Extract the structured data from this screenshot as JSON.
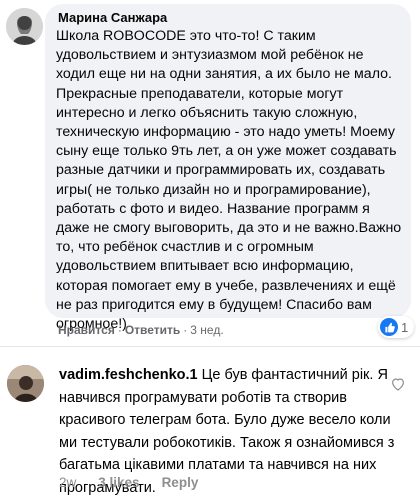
{
  "comment1": {
    "author": "Марина Санжара",
    "text": "Школа ROBOCODE это что-то! С таким удовольствием и энтузиазмом мой ребёнок не ходил еще ни на одни занятия, а их было не мало. Прекрасные преподаватели, которые могут интересно и легко объяснить такую сложную, техническую информацию - это надо уметь! Моему сыну еще только 9ть лет, а он уже может создавать разные датчики и программировать их, создавать игры( не только дизайн но и програмирование), работать с фото и видео. Название программ я даже не смогу выговорить, да это и не важно.Важно то, что ребёнок счастлив и с огромным удовольствием впитывает всю информацию, которая помогает ему в учебе, развлечениях и ещё не раз пригодится ему в будущем! Спасибо вам огромное!)",
    "like_label": "Нравится",
    "reply_label": "Ответить",
    "time": "3 нед.",
    "reaction_count": "1",
    "reaction_icon": "like-icon",
    "accent": "#1877f2"
  },
  "comment2": {
    "author": "vadim.feshchenko.1",
    "text": "Це був фантастичний рік. Я навчився програмувати роботів та створив красивого телеграм бота. Було дуже весело коли ми тестували робокотиків. Також я ознайомився з багатьма цікавими платами та навчився на них програмувати.",
    "time": "2w",
    "likes": "3 likes",
    "reply_label": "Reply",
    "like_icon": "heart-outline-icon"
  }
}
